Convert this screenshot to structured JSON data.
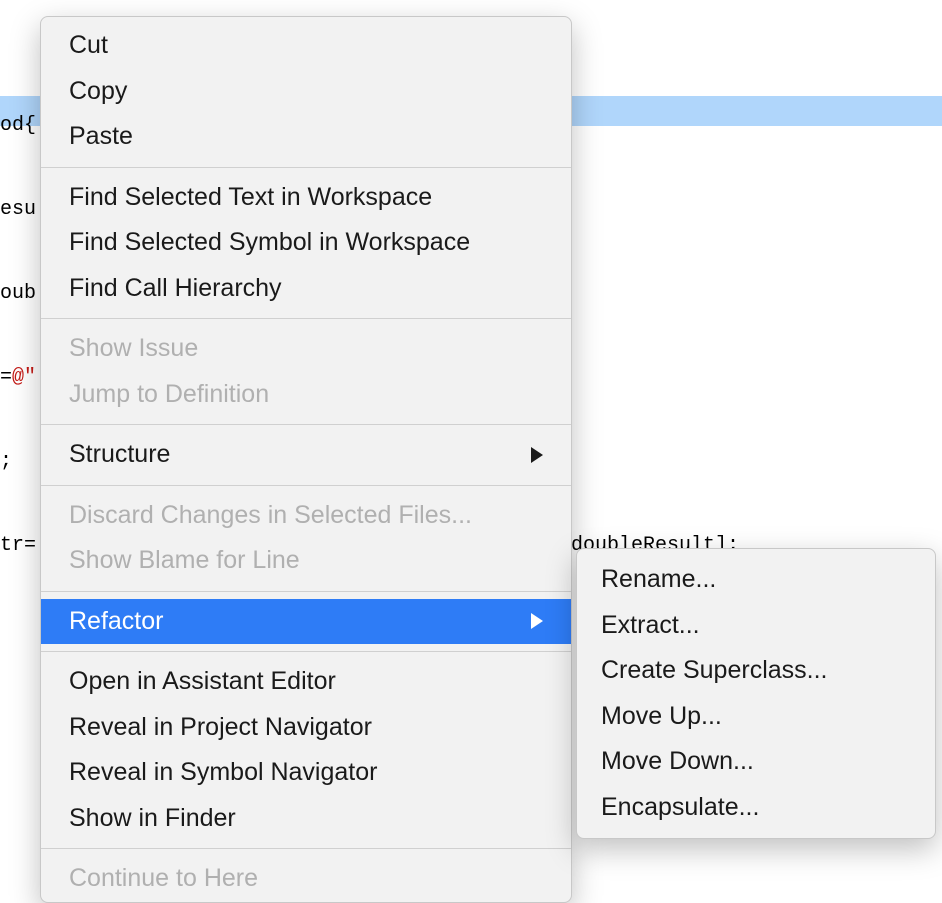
{
  "code": {
    "line1_fragment": "od{",
    "line2_fragment": "esu",
    "line3_fragment": "oub",
    "line4_prefix": "=",
    "line4_red": "@\"",
    "line5_fragment": ";",
    "line6_prefix": "tr=",
    "line6_suffix": "doubleResult];"
  },
  "menu": {
    "items": [
      {
        "label": "Cut",
        "disabled": false
      },
      {
        "label": "Copy",
        "disabled": false
      },
      {
        "label": "Paste",
        "disabled": false
      },
      {
        "type": "separator"
      },
      {
        "label": "Find Selected Text in Workspace",
        "disabled": false
      },
      {
        "label": "Find Selected Symbol in Workspace",
        "disabled": false
      },
      {
        "label": "Find Call Hierarchy",
        "disabled": false
      },
      {
        "type": "separator"
      },
      {
        "label": "Show Issue",
        "disabled": true
      },
      {
        "label": "Jump to Definition",
        "disabled": true
      },
      {
        "type": "separator"
      },
      {
        "label": "Structure",
        "disabled": false,
        "submenu": true
      },
      {
        "type": "separator"
      },
      {
        "label": "Discard Changes in Selected Files...",
        "disabled": true
      },
      {
        "label": "Show Blame for Line",
        "disabled": true
      },
      {
        "type": "separator"
      },
      {
        "label": "Refactor",
        "disabled": false,
        "submenu": true,
        "highlighted": true
      },
      {
        "type": "separator"
      },
      {
        "label": "Open in Assistant Editor",
        "disabled": false
      },
      {
        "label": "Reveal in Project Navigator",
        "disabled": false
      },
      {
        "label": "Reveal in Symbol Navigator",
        "disabled": false
      },
      {
        "label": "Show in Finder",
        "disabled": false
      },
      {
        "type": "separator"
      },
      {
        "label": "Continue to Here",
        "disabled": true
      }
    ]
  },
  "submenu": {
    "items": [
      {
        "label": "Rename..."
      },
      {
        "label": "Extract..."
      },
      {
        "label": "Create Superclass..."
      },
      {
        "label": "Move Up..."
      },
      {
        "label": "Move Down..."
      },
      {
        "label": "Encapsulate..."
      }
    ]
  }
}
